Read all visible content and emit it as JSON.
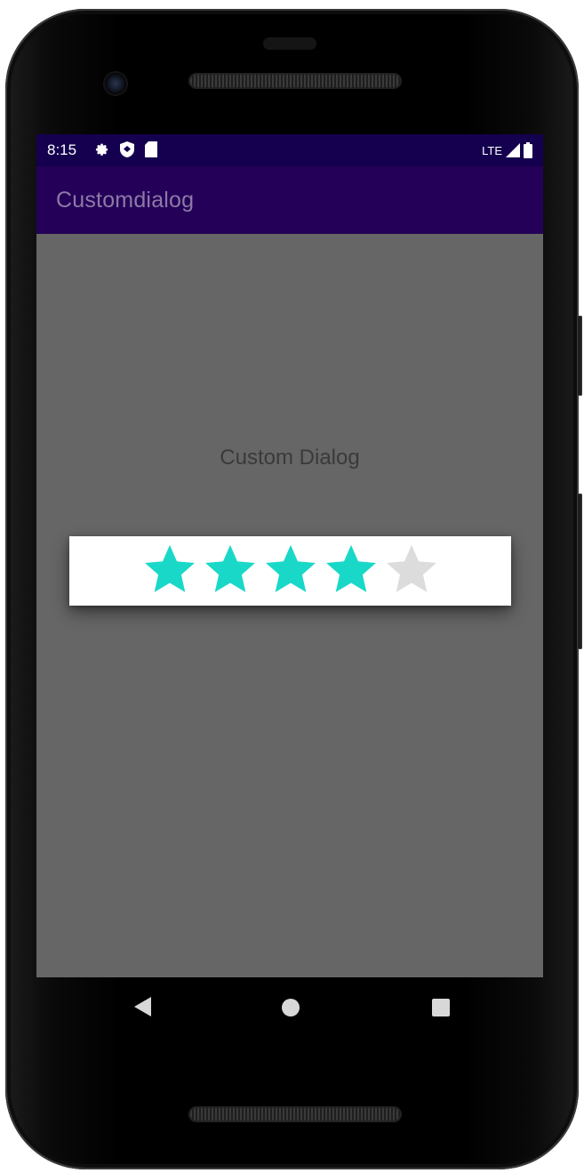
{
  "status_bar": {
    "time": "8:15",
    "left_icons": [
      "settings-icon",
      "shield-icon",
      "sd-card-icon"
    ],
    "network": "LTE",
    "right_icons": [
      "signal-icon",
      "battery-icon"
    ]
  },
  "app_bar": {
    "title": "Customdialog"
  },
  "main": {
    "label": "Custom Dialog"
  },
  "dialog": {
    "rating": {
      "value": 4,
      "max": 5
    }
  },
  "nav_bar": {
    "buttons": [
      "back-icon",
      "home-icon",
      "recents-icon"
    ]
  },
  "colors": {
    "status_bar_bg": "#14004e",
    "app_bar_bg": "#240058",
    "app_title": "#8c7aa6",
    "screen_bg": "#666666",
    "star_filled": "#19d8c8",
    "star_empty": "#dcdcdc",
    "dialog_bg": "#ffffff"
  }
}
